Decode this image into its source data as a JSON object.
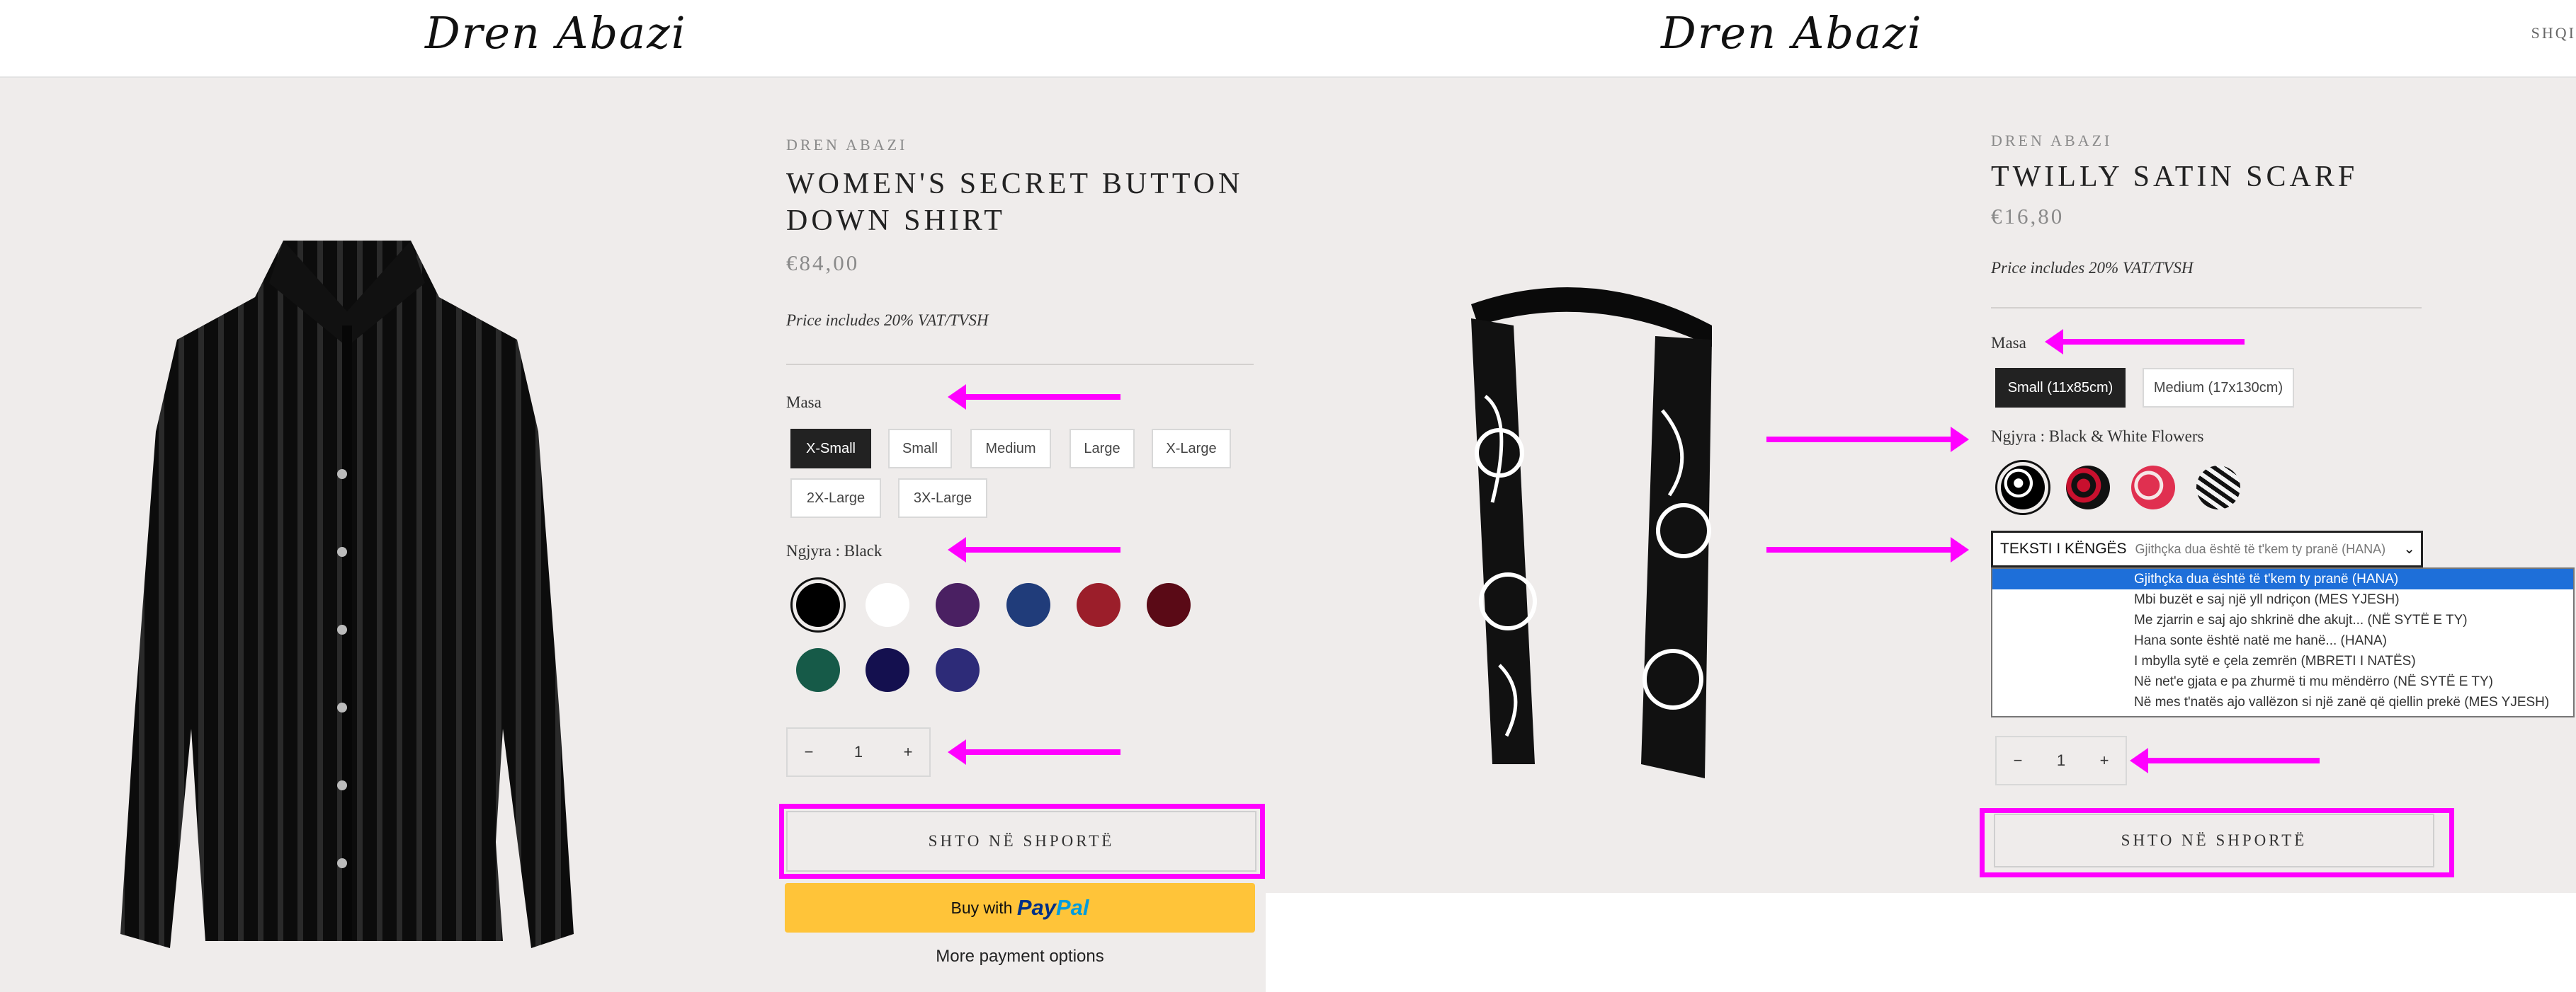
{
  "left": {
    "logo": "Dren Abazi",
    "brand": "DREN ABAZI",
    "title_line1": "WOMEN'S SECRET BUTTON",
    "title_line2": "DOWN SHIRT",
    "price": "€84,00",
    "vat_note": "Price includes 20% VAT/TVSH",
    "size_label": "Masa",
    "sizes": [
      "X-Small",
      "Small",
      "Medium",
      "Large",
      "X-Large",
      "2X-Large",
      "3X-Large"
    ],
    "selected_size": "X-Small",
    "color_label": "Ngjyra : Black",
    "swatch_colors": [
      "#000000",
      "#ffffff",
      "#4a2062",
      "#203c7a",
      "#9b1e2a",
      "#5a0a16",
      "#165a48",
      "#14104f",
      "#2d2b78"
    ],
    "quantity": "1",
    "minus": "−",
    "plus": "+",
    "add_to_cart": "SHTO NË SHPORTË",
    "paypal_prefix": "Buy with",
    "paypal_brand_1": "Pay",
    "paypal_brand_2": "Pal",
    "more_payment": "More payment options"
  },
  "right": {
    "logo": "Dren Abazi",
    "nav_partial": "SHQI",
    "brand": "DREN ABAZI",
    "title": "TWILLY SATIN SCARF",
    "price": "€16,80",
    "vat_note": "Price includes 20% VAT/TVSH",
    "size_label": "Masa",
    "sizes": [
      "Small (11x85cm)",
      "Medium (17x130cm)"
    ],
    "selected_size": "Small (11x85cm)",
    "color_label": "Ngjyra : Black & White Flowers",
    "lyrics_label": "TEKSTI I KËNGËS",
    "lyrics_selected": "Gjithçka dua është të t'kem ty pranë (HANA)",
    "lyrics_options": [
      "Gjithçka dua është të t'kem ty pranë (HANA)",
      "Mbi buzët e saj një yll ndriçon (MES YJESH)",
      "Me zjarrin e saj ajo shkrinë dhe akujt... (NË SYTË E TY)",
      "Hana sonte është natë me hanë... (HANA)",
      "I mbylla sytë e çela zemrën (MBRETI I NATËS)",
      "Në net'e gjata e pa zhurmë ti mu mëndërro (NË SYTË E TY)",
      "Në mes t'natës ajo vallëzon si një zanë që qiellin prekë (MES YJESH)"
    ],
    "quantity": "1",
    "minus": "−",
    "plus": "+",
    "add_to_cart": "SHTO NË SHPORTË"
  },
  "colors": {
    "highlight": "#ff00ff",
    "panel_bg": "#efeceb",
    "selected_option": "#1e6fd9",
    "paypal_yellow": "#ffc439"
  }
}
